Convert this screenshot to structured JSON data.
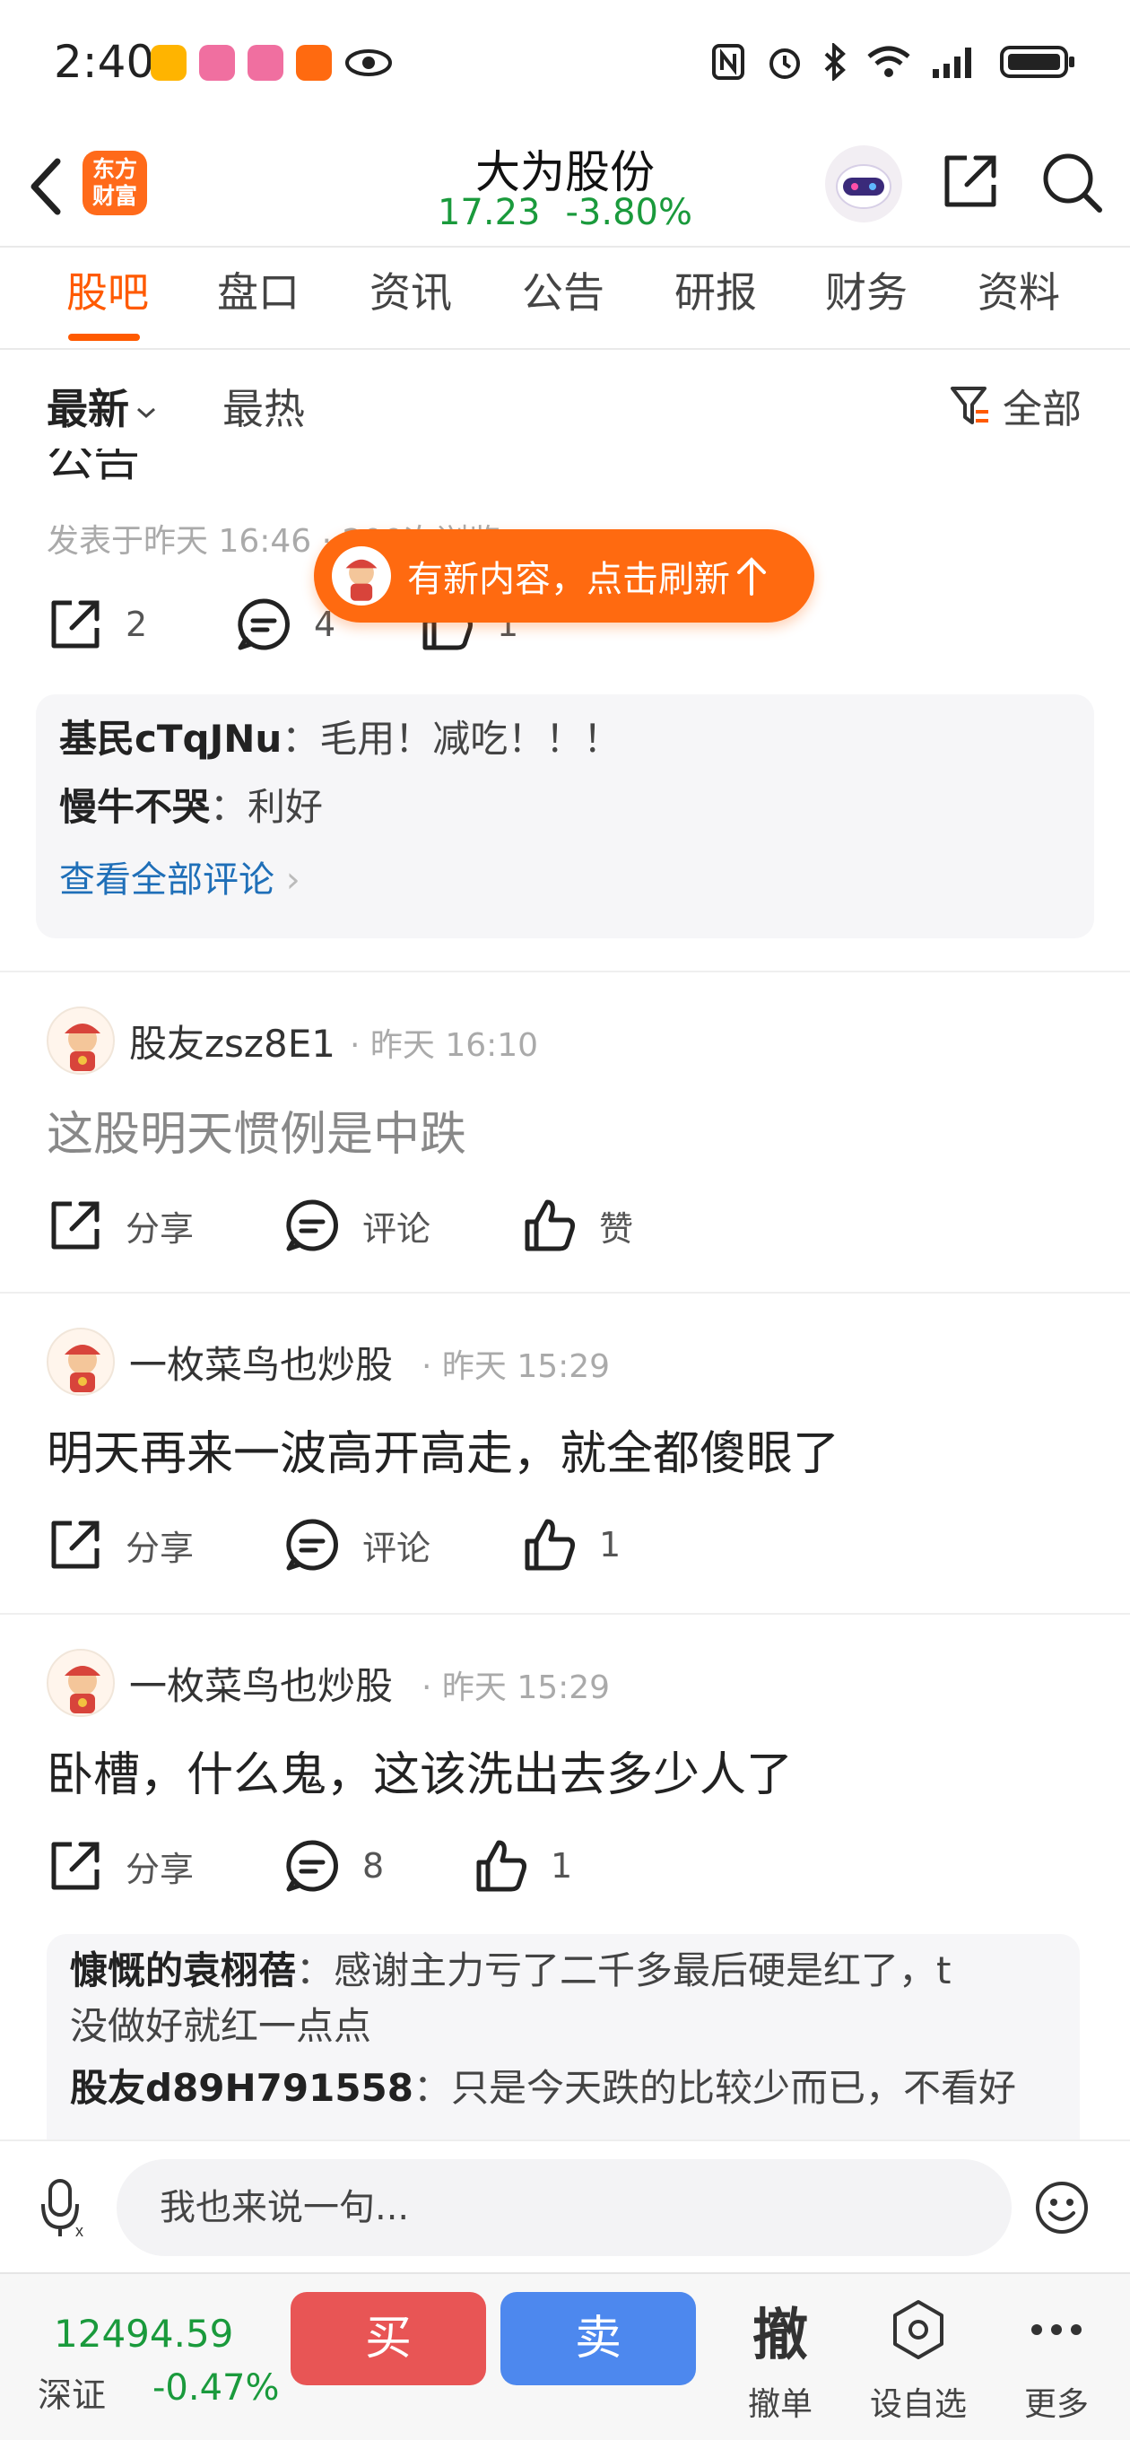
{
  "status_bar": {
    "time": "2:40"
  },
  "header": {
    "logo_text": "东方\n财富",
    "stock_name": "大为股份",
    "price": "17.23",
    "change_pct": "-3.80%"
  },
  "tabs": [
    {
      "label": "股吧",
      "active": true
    },
    {
      "label": "盘口"
    },
    {
      "label": "资讯"
    },
    {
      "label": "公告"
    },
    {
      "label": "研报"
    },
    {
      "label": "财务"
    },
    {
      "label": "资料"
    }
  ],
  "filters": {
    "latest": "最新",
    "hot": "最热",
    "all": "全部"
  },
  "toast": {
    "text": "有新内容，点击刷新"
  },
  "first_post": {
    "clipped_title": "公告",
    "meta": "发表于昨天 16:46 · 200次浏览",
    "share_count": "2",
    "comment_count": "4",
    "like_count": "1",
    "comments": [
      {
        "user": "基民cTqJNu",
        "text": "：毛用！减吃！！！"
      },
      {
        "user": "慢牛不哭",
        "text": "：利好"
      }
    ],
    "view_all": "查看全部评论"
  },
  "posts": [
    {
      "user": "股友zsz8E1",
      "time": "昨天 16:10",
      "text": "这股明天惯例是中跌",
      "share": "分享",
      "comment": "评论",
      "like": "赞"
    },
    {
      "user": "一枚菜鸟也炒股",
      "time": "昨天 15:29",
      "text": "明天再来一波高开高走，就全都傻眼了",
      "share": "分享",
      "comment": "评论",
      "like": "1"
    },
    {
      "user": "一枚菜鸟也炒股",
      "time": "昨天 15:29",
      "text": "卧槽，什么鬼，这该洗出去多少人了",
      "share": "分享",
      "comment": "8",
      "like": "1",
      "comments": [
        {
          "user": "慷慨的袁栩蓓",
          "text": "：感谢主力亏了二千多最后硬是红了，t",
          "text2": "没做好就红一点点"
        },
        {
          "user": "股友d89H791558",
          "text": "：只是今天跌的比较少而已，不看好"
        }
      ]
    }
  ],
  "input_bar": {
    "placeholder": "我也来说一句..."
  },
  "trade_bar": {
    "index_value": "12494.59",
    "index_name": "深证",
    "index_change": "-0.47%",
    "buy": "买",
    "sell": "卖",
    "cancel_icon_text": "撤",
    "cancel": "撤单",
    "watchlist": "设自选",
    "more": "更多"
  },
  "colors": {
    "accent": "#ff5a00",
    "down": "#1a9a3c",
    "buy": "#e85555",
    "sell": "#4d88ee"
  }
}
